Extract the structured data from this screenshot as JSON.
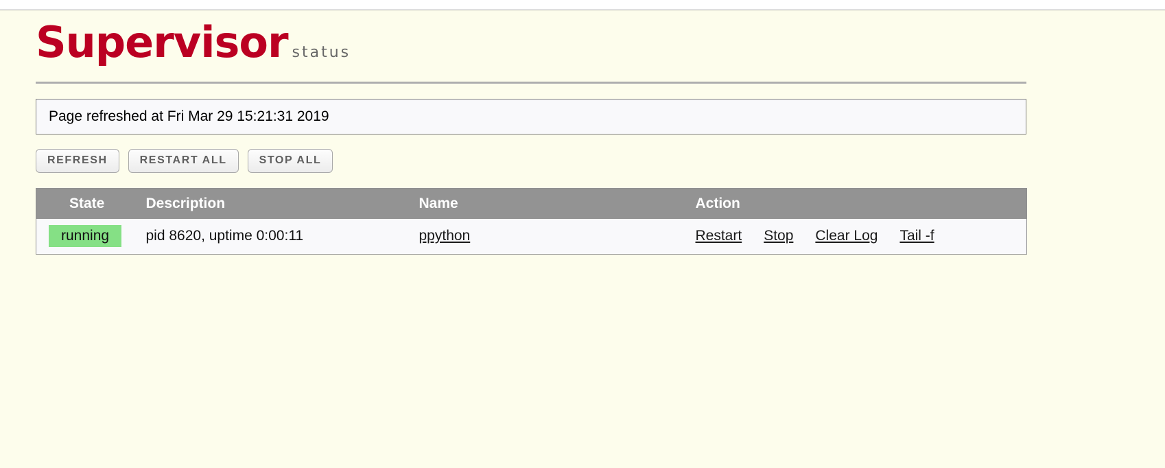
{
  "header": {
    "logo_main": "Supervisor",
    "logo_sub": "status"
  },
  "status": {
    "message": "Page refreshed at Fri Mar 29 15:21:31 2019"
  },
  "toolbar": {
    "refresh_label": "REFRESH",
    "restart_all_label": "RESTART ALL",
    "stop_all_label": "STOP ALL"
  },
  "table": {
    "columns": {
      "state": "State",
      "description": "Description",
      "name": "Name",
      "action": "Action"
    },
    "rows": [
      {
        "state": "running",
        "description": "pid 8620, uptime 0:00:11",
        "name": "ppython",
        "actions": {
          "restart": "Restart",
          "stop": "Stop",
          "clear_log": "Clear Log",
          "tail": "Tail -f"
        }
      }
    ]
  },
  "colors": {
    "page_background": "#fdfdec",
    "logo_red": "#bb0022",
    "table_header_gray": "#939393",
    "row_background": "#f9f9fb",
    "state_running_green": "#85e085",
    "button_text_gray": "#5f5f5f"
  }
}
